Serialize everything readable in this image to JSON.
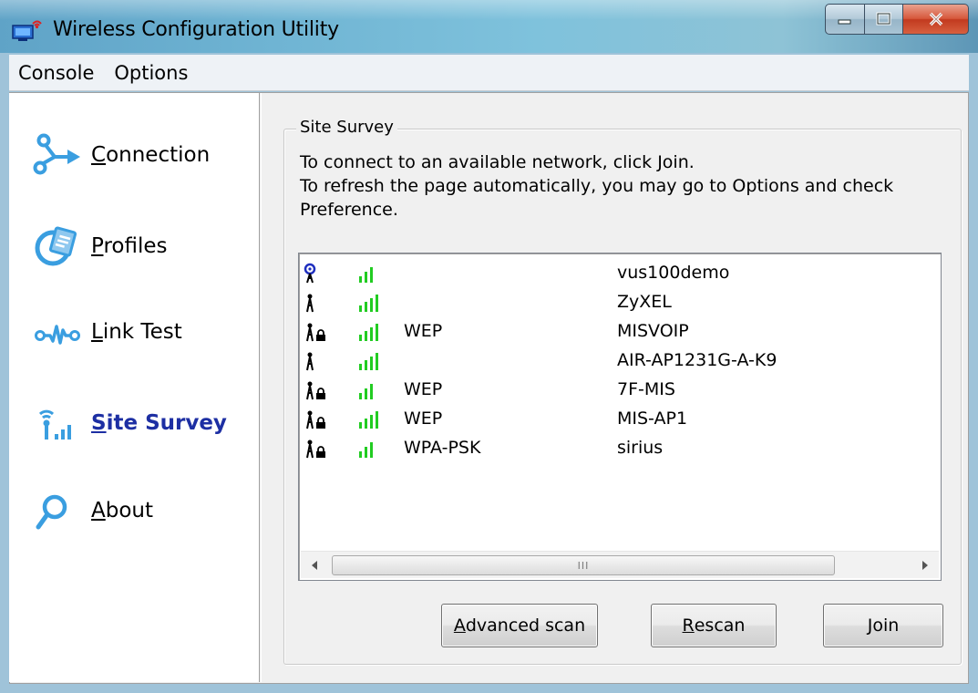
{
  "window": {
    "title": "Wireless Configuration Utility",
    "icon": "network-icon"
  },
  "menubar": {
    "items": [
      {
        "label": "Console"
      },
      {
        "label": "Options"
      }
    ]
  },
  "sidebar": {
    "items": [
      {
        "key": "C",
        "rest": "onnection",
        "icon": "connection-icon",
        "active": false
      },
      {
        "key": "P",
        "rest": "rofiles",
        "icon": "profiles-icon",
        "active": false
      },
      {
        "key": "L",
        "rest": "ink Test",
        "icon": "link-test-icon",
        "active": false
      },
      {
        "key": "S",
        "rest": "ite Survey",
        "icon": "site-survey-icon",
        "active": true
      },
      {
        "key": "A",
        "rest": "bout",
        "icon": "about-icon",
        "active": false
      }
    ]
  },
  "site_survey": {
    "legend": "Site Survey",
    "instructions": [
      "To connect to an available network, click Join.",
      "To refresh the page automatically, you may go to Options and check",
      "Preference."
    ],
    "networks": [
      {
        "type": "connected",
        "signal_bars": 3,
        "encryption": "",
        "ssid": "vus100demo",
        "icon": "connected-ap-icon"
      },
      {
        "type": "open",
        "signal_bars": 4,
        "encryption": "",
        "ssid": "ZyXEL",
        "icon": "access-point-icon"
      },
      {
        "type": "secured",
        "signal_bars": 4,
        "encryption": "WEP",
        "ssid": "MISVOIP",
        "icon": "secured-access-point-icon"
      },
      {
        "type": "open",
        "signal_bars": 4,
        "encryption": "",
        "ssid": "AIR-AP1231G-A-K9",
        "icon": "access-point-icon"
      },
      {
        "type": "secured",
        "signal_bars": 3,
        "encryption": "WEP",
        "ssid": "7F-MIS",
        "icon": "secured-access-point-icon"
      },
      {
        "type": "secured",
        "signal_bars": 4,
        "encryption": "WEP",
        "ssid": "MIS-AP1",
        "icon": "secured-access-point-icon"
      },
      {
        "type": "secured",
        "signal_bars": 3,
        "encryption": "WPA-PSK",
        "ssid": "sirius",
        "icon": "secured-access-point-icon"
      }
    ],
    "scrollbar": {
      "grip": "III"
    }
  },
  "buttons": {
    "advanced_scan": {
      "key": "A",
      "rest": "dvanced scan"
    },
    "rescan": {
      "key": "R",
      "rest": "escan"
    },
    "join": {
      "key": "J",
      "rest": "oin"
    }
  },
  "colors": {
    "active_nav": "#1d2fa3",
    "signal_green": "#22cc22",
    "icon_blue": "#3a9ee0"
  }
}
